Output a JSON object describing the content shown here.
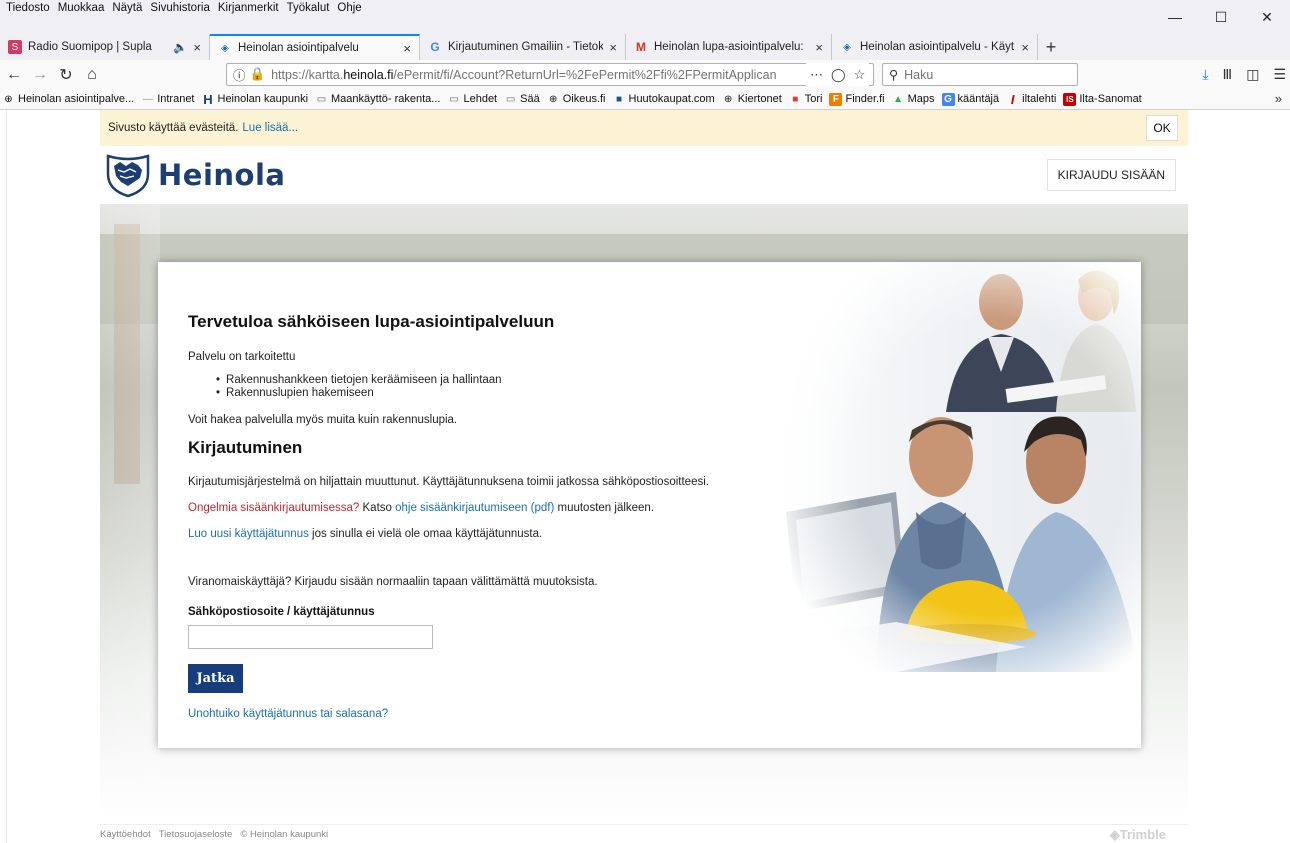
{
  "menubar": {
    "items": [
      "Tiedosto",
      "Muokkaa",
      "Näytä",
      "Sivuhistoria",
      "Kirjanmerkit",
      "Työkalut",
      "Ohje"
    ]
  },
  "tabs": [
    {
      "title": "Radio Suomipop | Supla",
      "icon": "S",
      "icon_color": "#d33a6b",
      "close": "×",
      "audio": "🔊"
    },
    {
      "title": "Heinolan asiointipalvelu",
      "icon": "◈",
      "icon_color": "#1a6fb3",
      "close": "×"
    },
    {
      "title": "Kirjautuminen Gmailiin - Tietok",
      "icon": "G",
      "icon_color": "#4285f4",
      "close": "×"
    },
    {
      "title": "Heinolan lupa-asiointipalvelu:",
      "icon": "M",
      "icon_color": "#d93025",
      "close": "×"
    },
    {
      "title": "Heinolan asiointipalvelu - Käyt",
      "icon": "◈",
      "icon_color": "#1a6fb3",
      "close": "×"
    }
  ],
  "newtab": "+",
  "url": {
    "prefix": "https://kartta.",
    "host": "heinola.fi",
    "path": "/ePermit/fi/Account?ReturnUrl=%2FePermit%2Ffi%2FPermitApplican"
  },
  "search": {
    "placeholder": "Haku"
  },
  "bookmarks": [
    {
      "label": "Heinolan asiointipalve...",
      "icon": "⊕",
      "color": "#333"
    },
    {
      "label": "Intranet",
      "icon": "—",
      "color": "#888"
    },
    {
      "label": "Heinolan kaupunki",
      "icon": "H",
      "color": "#1c3e70"
    },
    {
      "label": "Maankäyttö- rakenta...",
      "icon": "▭",
      "color": "#666"
    },
    {
      "label": "Lehdet",
      "icon": "▭",
      "color": "#666"
    },
    {
      "label": "Sää",
      "icon": "▭",
      "color": "#666"
    },
    {
      "label": "Oikeus.fi",
      "icon": "⊕",
      "color": "#333"
    },
    {
      "label": "Huutokaupat.com",
      "icon": "■",
      "color": "#1a4f9c"
    },
    {
      "label": "Kiertonet",
      "icon": "⊕",
      "color": "#333"
    },
    {
      "label": "Tori",
      "icon": "■",
      "color": "#e53935"
    },
    {
      "label": "Finder.fi",
      "icon": "F",
      "color": "#f07c00"
    },
    {
      "label": "Maps",
      "icon": "▲",
      "color": "#34a853"
    },
    {
      "label": "kääntäjä",
      "icon": "G",
      "color": "#4285f4"
    },
    {
      "label": "iltalehti",
      "icon": "I",
      "color": "#d40000"
    },
    {
      "label": "Ilta-Sanomat",
      "icon": "IS",
      "color": "#c40000"
    }
  ],
  "cookie": {
    "text": "Sivusto käyttää evästeitä.",
    "link": "Lue lisää...",
    "ok": "OK"
  },
  "header": {
    "logo_text": "Heinola",
    "login": "KIRJAUDU SISÄÄN"
  },
  "card": {
    "title": "Tervetuloa sähköiseen lupa-asiointipalveluun",
    "intro": "Palvelu on tarkoitettu",
    "bullets": [
      "Rakennushankkeen tietojen keräämiseen ja hallintaan",
      "Rakennuslupien hakemiseen"
    ],
    "other": "Voit hakea palvelulla myös muita kuin rakennuslupia.",
    "login_heading": "Kirjautuminen",
    "changed": "Kirjautumisjärjestelmä on hiljattain muuttunut. Käyttäjätunnuksena toimii jatkossa sähköpostiosoitteesi.",
    "problems": "Ongelmia sisäänkirjautumisessa?",
    "problems_mid": " Katso ",
    "problems_link": "ohje sisäänkirjautumiseen (pdf)",
    "problems_end": " muutosten jälkeen.",
    "new_user_link": "Luo uusi käyttäjätunnus",
    "new_user_rest": " jos sinulla ei vielä ole omaa käyttäjätunnusta.",
    "authority": "Viranomaiskäyttäjä? Kirjaudu sisään normaaliin tapaan välittämättä muutoksista.",
    "field_label": "Sähköpostiosoite / käyttäjätunnus",
    "field_value": "",
    "button": "Jatka",
    "forgot": "Unohtuiko käyttäjätunnus tai salasana?"
  },
  "footer": {
    "terms": "Käyttöehdot",
    "privacy": "Tietosuojaseloste",
    "copyright": "© Heinolan kaupunki",
    "brand": "Trimble"
  }
}
